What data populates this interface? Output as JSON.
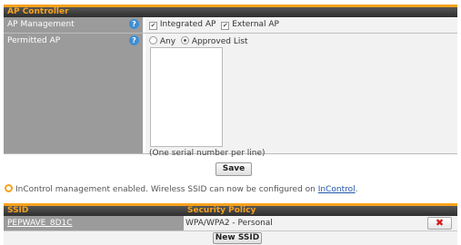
{
  "section": {
    "title": "AP Controller"
  },
  "ap_management": {
    "label": "AP Management",
    "help": "?",
    "integrated_label": "Integrated AP",
    "external_label": "External AP"
  },
  "permitted_ap": {
    "label": "Permitted AP",
    "help": "?",
    "any_label": "Any",
    "approved_label": "Approved List",
    "selected": "Approved List",
    "hint": "(One serial number per line)"
  },
  "save_label": "Save",
  "info": {
    "text": "InControl management enabled. Wireless SSID can now be configured on ",
    "link": "InControl",
    "suffix": "."
  },
  "table": {
    "col_ssid": "SSID",
    "col_policy": "Security Policy",
    "rows": [
      {
        "ssid": "PEPWAVE_8D1C",
        "policy": "WPA/WPA2 - Personal"
      }
    ],
    "delete_icon": "✖",
    "new_ssid_label": "New SSID"
  },
  "colors": {
    "accent": "#f7a21c",
    "label_bg": "#9b9b9b",
    "help_icon": "#3f8fd2",
    "delete_icon": "#d21d1d"
  }
}
